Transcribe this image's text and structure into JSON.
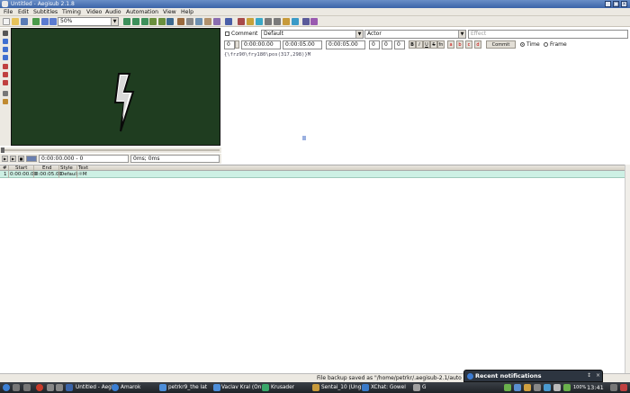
{
  "window": {
    "title": "Untitled - Aegisub 2.1.8",
    "controls": [
      "_",
      "□",
      "×"
    ]
  },
  "menu": [
    "File",
    "Edit",
    "Subtitles",
    "Timing",
    "Video",
    "Audio",
    "Automation",
    "View",
    "Help"
  ],
  "toolbar": {
    "zoom_value": "50%"
  },
  "video_controls": {
    "time_frame": "0:00:00.000 - 0",
    "offset": "0ms; 0ms"
  },
  "editor": {
    "comment_label": "Comment",
    "style_value": "Default",
    "actor_value": "Actor",
    "effect_placeholder": "Effect",
    "layer_value": "0",
    "start_time": "0:00:00.00",
    "end_time": "0:00:05.00",
    "duration": "0:00:05.00",
    "margin_l": "0",
    "margin_r": "0",
    "margin_v": "0",
    "format_buttons": [
      "B",
      "I",
      "U",
      "S",
      "fn",
      "a",
      "b",
      "c",
      "d"
    ],
    "commit_label": "Commit",
    "time_label": "Time",
    "frame_label": "Frame",
    "text_value": "{\\frz90\\fry180\\pos(317,298)}M"
  },
  "grid": {
    "columns": [
      "#",
      "Start",
      "End",
      "Style",
      "Text"
    ],
    "rows": [
      {
        "num": "1",
        "start": "0:00:00.00",
        "end": "0:00:05.00",
        "style": "Default",
        "text": "☼M"
      }
    ]
  },
  "status": {
    "message": "File backup saved as \"/home/petrkr/.aegisub-2.1/auto"
  },
  "notification": {
    "title": "Recent notifications",
    "buttons": [
      "↕",
      "×"
    ]
  },
  "taskbar": {
    "items": [
      "Untitled - Aegi",
      "Amarok",
      "petrkr9_the lat",
      "Vaclav Kral (On",
      "Krusader",
      "Sentai_10 (Ung",
      "XChat: Gowel",
      "G"
    ],
    "battery": "100%",
    "clock": "13:41"
  },
  "colors": {
    "video_bg": "#1f3d20",
    "grid_selected": "#cdf0e4",
    "title_blue": "#3b64a8"
  }
}
